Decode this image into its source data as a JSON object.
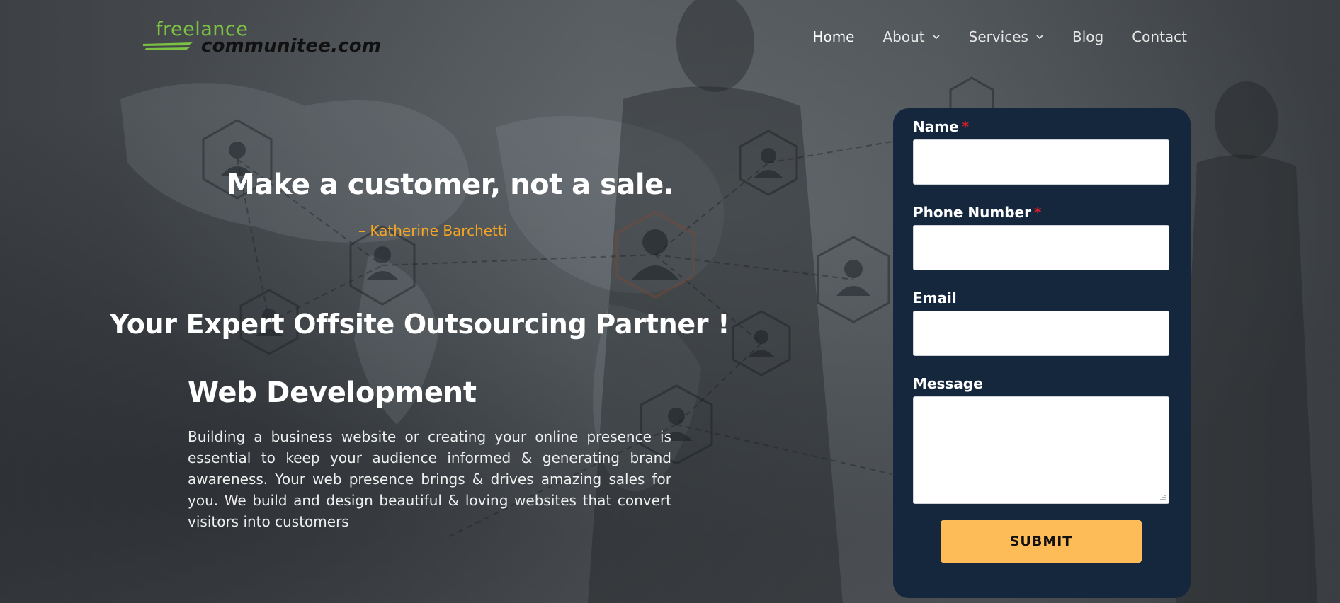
{
  "header": {
    "logo": {
      "line1": "freelance",
      "line2": "communitee.com"
    },
    "nav": [
      {
        "label": "Home",
        "has_dropdown": false,
        "active": true
      },
      {
        "label": "About",
        "has_dropdown": true,
        "active": false
      },
      {
        "label": "Services",
        "has_dropdown": true,
        "active": false
      },
      {
        "label": "Blog",
        "has_dropdown": false,
        "active": false
      },
      {
        "label": "Contact",
        "has_dropdown": false,
        "active": false
      }
    ]
  },
  "hero": {
    "quote": "Make a customer, not a sale.",
    "quote_author": "– Katherine Barchetti",
    "tagline": "Your Expert Offsite Outsourcing Partner !",
    "service_title": "Web Development",
    "service_description": "Building a business website or creating your online presence is essential to keep your audience informed & generating brand awareness. Your web presence brings & drives amazing sales for you. We build and design beautiful & loving websites that convert visitors into customers"
  },
  "contact_form": {
    "fields": [
      {
        "label": "Name",
        "required": true,
        "value": ""
      },
      {
        "label": "Phone Number",
        "required": true,
        "value": ""
      },
      {
        "label": "Email",
        "required": false,
        "value": ""
      },
      {
        "label": "Message",
        "required": false,
        "value": ""
      }
    ],
    "required_marker": "*",
    "submit_label": "SUBMIT"
  },
  "colors": {
    "logo_green": "#7cc142",
    "quote_author": "#f6a623",
    "form_background": "#14273d",
    "submit_button": "#fdbc58",
    "required_marker": "#e11d2b"
  }
}
